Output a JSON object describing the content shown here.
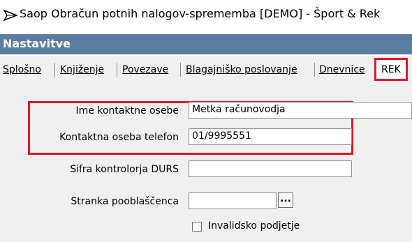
{
  "window": {
    "title": "Saop Obračun potnih nalogov-sprememba [DEMO] - Šport & Rek",
    "app_icon": "arrow-app-icon"
  },
  "section": {
    "title": "Nastavitve"
  },
  "tabs": [
    {
      "label": "Splošno",
      "active": false
    },
    {
      "label": "Knjiženje",
      "active": false
    },
    {
      "label": "Povezave",
      "active": false
    },
    {
      "label": "Blagajniško poslovanje",
      "active": false
    },
    {
      "label": "Dnevnice",
      "active": false
    },
    {
      "label": "REK",
      "active": true
    }
  ],
  "form": {
    "contact_name_label": "Ime kontaktne osebe",
    "contact_name_value": "Metka računovodja",
    "contact_phone_label": "Kontaktna oseba telefon",
    "contact_phone_value": "01/9995551",
    "controller_id_label": "Sifra kontrolorja DURS",
    "controller_id_value": "",
    "authorized_party_label": "Stranka pooblaščenca",
    "authorized_party_value": "",
    "browse_label": "...",
    "disabled_company_label": "Invalidsko podjetje",
    "disabled_company_checked": false
  },
  "colors": {
    "header_bg": "#5d7ca2",
    "highlight": "#e4172a",
    "panel_bg": "#f0f0f0"
  }
}
